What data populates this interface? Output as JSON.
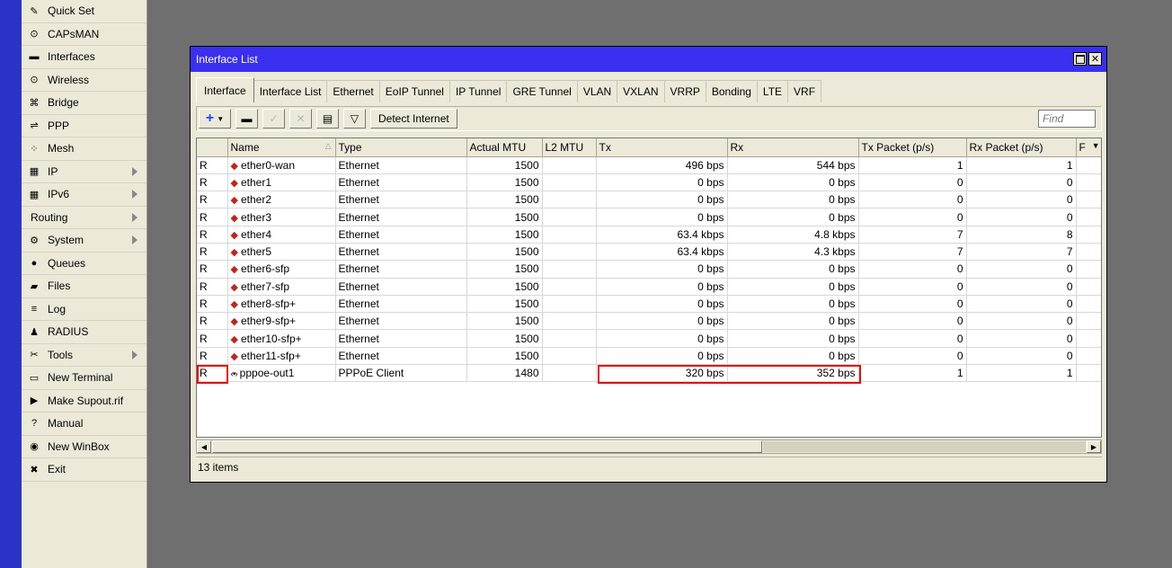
{
  "menu": {
    "items": [
      {
        "label": "Quick Set",
        "icon": "wand-icon",
        "glyph": "✎",
        "arrow": false
      },
      {
        "label": "CAPsMAN",
        "icon": "capsman-icon",
        "glyph": "⊙",
        "arrow": false
      },
      {
        "label": "Interfaces",
        "icon": "interfaces-icon",
        "glyph": "▬",
        "arrow": false
      },
      {
        "label": "Wireless",
        "icon": "wireless-icon",
        "glyph": "⊙",
        "arrow": false
      },
      {
        "label": "Bridge",
        "icon": "bridge-icon",
        "glyph": "⌘",
        "arrow": false
      },
      {
        "label": "PPP",
        "icon": "ppp-icon",
        "glyph": "⇌",
        "arrow": false
      },
      {
        "label": "Mesh",
        "icon": "mesh-icon",
        "glyph": "⁘",
        "arrow": false
      },
      {
        "label": "IP",
        "icon": "ip-icon",
        "glyph": "▦",
        "arrow": true
      },
      {
        "label": "IPv6",
        "icon": "ipv6-icon",
        "glyph": "▦",
        "arrow": true
      },
      {
        "label": "Routing",
        "icon": "",
        "glyph": "",
        "arrow": true
      },
      {
        "label": "System",
        "icon": "system-icon",
        "glyph": "⚙",
        "arrow": true
      },
      {
        "label": "Queues",
        "icon": "queues-icon",
        "glyph": "●",
        "arrow": false
      },
      {
        "label": "Files",
        "icon": "files-icon",
        "glyph": "▰",
        "arrow": false
      },
      {
        "label": "Log",
        "icon": "log-icon",
        "glyph": "≡",
        "arrow": false
      },
      {
        "label": "RADIUS",
        "icon": "radius-icon",
        "glyph": "♟",
        "arrow": false
      },
      {
        "label": "Tools",
        "icon": "tools-icon",
        "glyph": "✂",
        "arrow": true
      },
      {
        "label": "New Terminal",
        "icon": "terminal-icon",
        "glyph": "▭",
        "arrow": false
      },
      {
        "label": "Make Supout.rif",
        "icon": "supout-icon",
        "glyph": "▶",
        "arrow": false
      },
      {
        "label": "Manual",
        "icon": "manual-icon",
        "glyph": "?",
        "arrow": false
      },
      {
        "label": "New WinBox",
        "icon": "winbox-icon",
        "glyph": "◉",
        "arrow": false
      },
      {
        "label": "Exit",
        "icon": "exit-icon",
        "glyph": "✖",
        "arrow": false
      }
    ]
  },
  "window": {
    "title": "Interface List",
    "tabs": [
      "Interface",
      "Interface List",
      "Ethernet",
      "EoIP Tunnel",
      "IP Tunnel",
      "GRE Tunnel",
      "VLAN",
      "VXLAN",
      "VRRP",
      "Bonding",
      "LTE",
      "VRF"
    ],
    "active_tab": 0,
    "toolbar": {
      "add": "+",
      "detect": "Detect Internet",
      "find_placeholder": "Find"
    },
    "columns": [
      "",
      "Name",
      "Type",
      "Actual MTU",
      "L2 MTU",
      "Tx",
      "Rx",
      "Tx Packet (p/s)",
      "Rx Packet (p/s)",
      "F"
    ],
    "rows": [
      {
        "flag": "R",
        "name": "ether0-wan",
        "type": "Ethernet",
        "mtu": "1500",
        "l2mtu": "",
        "tx": "496 bps",
        "rx": "544 bps",
        "txp": "1",
        "rxp": "1",
        "kind": "eth"
      },
      {
        "flag": "R",
        "name": "ether1",
        "type": "Ethernet",
        "mtu": "1500",
        "l2mtu": "",
        "tx": "0 bps",
        "rx": "0 bps",
        "txp": "0",
        "rxp": "0",
        "kind": "eth"
      },
      {
        "flag": "R",
        "name": "ether2",
        "type": "Ethernet",
        "mtu": "1500",
        "l2mtu": "",
        "tx": "0 bps",
        "rx": "0 bps",
        "txp": "0",
        "rxp": "0",
        "kind": "eth"
      },
      {
        "flag": "R",
        "name": "ether3",
        "type": "Ethernet",
        "mtu": "1500",
        "l2mtu": "",
        "tx": "0 bps",
        "rx": "0 bps",
        "txp": "0",
        "rxp": "0",
        "kind": "eth"
      },
      {
        "flag": "R",
        "name": "ether4",
        "type": "Ethernet",
        "mtu": "1500",
        "l2mtu": "",
        "tx": "63.4 kbps",
        "rx": "4.8 kbps",
        "txp": "7",
        "rxp": "8",
        "kind": "eth"
      },
      {
        "flag": "R",
        "name": "ether5",
        "type": "Ethernet",
        "mtu": "1500",
        "l2mtu": "",
        "tx": "63.4 kbps",
        "rx": "4.3 kbps",
        "txp": "7",
        "rxp": "7",
        "kind": "eth"
      },
      {
        "flag": "R",
        "name": "ether6-sfp",
        "type": "Ethernet",
        "mtu": "1500",
        "l2mtu": "",
        "tx": "0 bps",
        "rx": "0 bps",
        "txp": "0",
        "rxp": "0",
        "kind": "eth"
      },
      {
        "flag": "R",
        "name": "ether7-sfp",
        "type": "Ethernet",
        "mtu": "1500",
        "l2mtu": "",
        "tx": "0 bps",
        "rx": "0 bps",
        "txp": "0",
        "rxp": "0",
        "kind": "eth"
      },
      {
        "flag": "R",
        "name": "ether8-sfp+",
        "type": "Ethernet",
        "mtu": "1500",
        "l2mtu": "",
        "tx": "0 bps",
        "rx": "0 bps",
        "txp": "0",
        "rxp": "0",
        "kind": "eth"
      },
      {
        "flag": "R",
        "name": "ether9-sfp+",
        "type": "Ethernet",
        "mtu": "1500",
        "l2mtu": "",
        "tx": "0 bps",
        "rx": "0 bps",
        "txp": "0",
        "rxp": "0",
        "kind": "eth"
      },
      {
        "flag": "R",
        "name": "ether10-sfp+",
        "type": "Ethernet",
        "mtu": "1500",
        "l2mtu": "",
        "tx": "0 bps",
        "rx": "0 bps",
        "txp": "0",
        "rxp": "0",
        "kind": "eth"
      },
      {
        "flag": "R",
        "name": "ether11-sfp+",
        "type": "Ethernet",
        "mtu": "1500",
        "l2mtu": "",
        "tx": "0 bps",
        "rx": "0 bps",
        "txp": "0",
        "rxp": "0",
        "kind": "eth"
      },
      {
        "flag": "R",
        "name": "pppoe-out1",
        "type": "PPPoE Client",
        "mtu": "1480",
        "l2mtu": "",
        "tx": "320 bps",
        "rx": "352 bps",
        "txp": "1",
        "rxp": "1",
        "kind": "pppoe"
      }
    ],
    "status": "13 items"
  },
  "colors": {
    "title_bar": "#3b2ff0",
    "highlight": "#e11111",
    "side_strip": "#2a33c8"
  }
}
